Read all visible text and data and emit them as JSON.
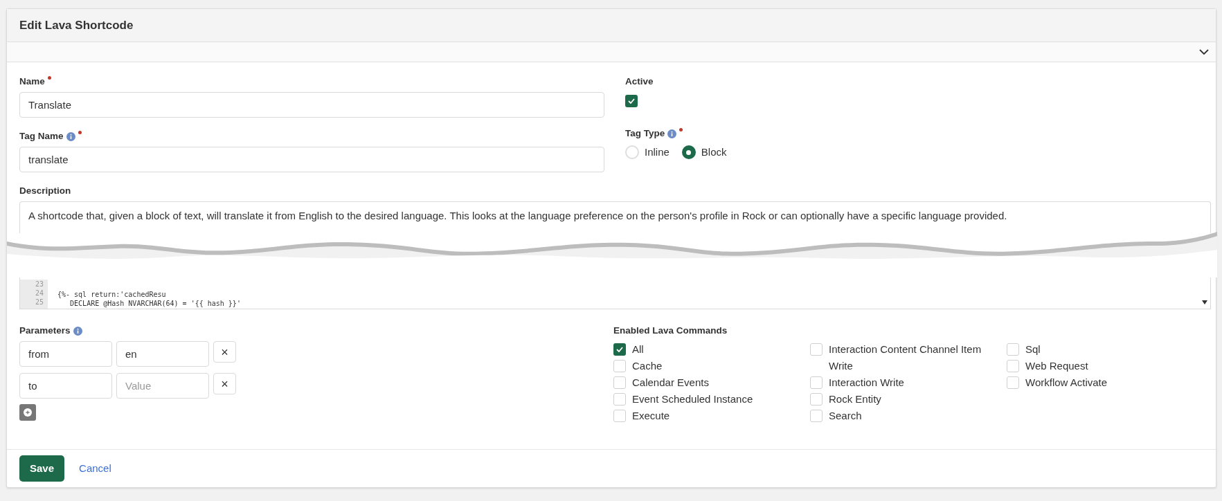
{
  "panel": {
    "title": "Edit Lava Shortcode"
  },
  "fields": {
    "name": {
      "label": "Name",
      "required": true,
      "value": "Translate"
    },
    "tag_name": {
      "label": "Tag Name",
      "required": true,
      "value": "translate"
    },
    "active": {
      "label": "Active",
      "checked": true
    },
    "tag_type": {
      "label": "Tag Type",
      "required": true,
      "options": [
        {
          "label": "Inline",
          "selected": false
        },
        {
          "label": "Block",
          "selected": true
        }
      ]
    },
    "description": {
      "label": "Description",
      "value": "A shortcode that, given a block of text, will translate it from English to the desired language. This looks at the language preference on the person's profile in Rock or can optionally have a specific language provided."
    }
  },
  "code": {
    "lines": [
      {
        "number": "23"
      },
      {
        "number": "24",
        "text": "{%- sql return:'cachedResu"
      },
      {
        "number": "25",
        "text": "   DECLARE @Hash NVARCHAR(64) = '{{ hash }}'"
      }
    ]
  },
  "parameters": {
    "label": "Parameters",
    "rows": [
      {
        "key": "from",
        "value": "en",
        "remove": "×"
      },
      {
        "key": "to",
        "placeholder": "Value",
        "remove": "×"
      }
    ]
  },
  "commands": {
    "label": "Enabled Lava Commands",
    "columns": [
      [
        {
          "label": "All",
          "checked": true
        },
        {
          "label": "Cache",
          "checked": false
        },
        {
          "label": "Calendar Events",
          "checked": false
        },
        {
          "label": "Event Scheduled Instance",
          "checked": false
        },
        {
          "label": "Execute",
          "checked": false
        }
      ],
      [
        {
          "label": "Interaction Content Channel Item Write",
          "checked": false
        },
        {
          "label": "Interaction Write",
          "checked": false
        },
        {
          "label": "Rock Entity",
          "checked": false
        },
        {
          "label": "Search",
          "checked": false
        }
      ],
      [
        {
          "label": "Sql",
          "checked": false
        },
        {
          "label": "Web Request",
          "checked": false
        },
        {
          "label": "Workflow Activate",
          "checked": false
        }
      ]
    ]
  },
  "actions": {
    "save": "Save",
    "cancel": "Cancel"
  }
}
